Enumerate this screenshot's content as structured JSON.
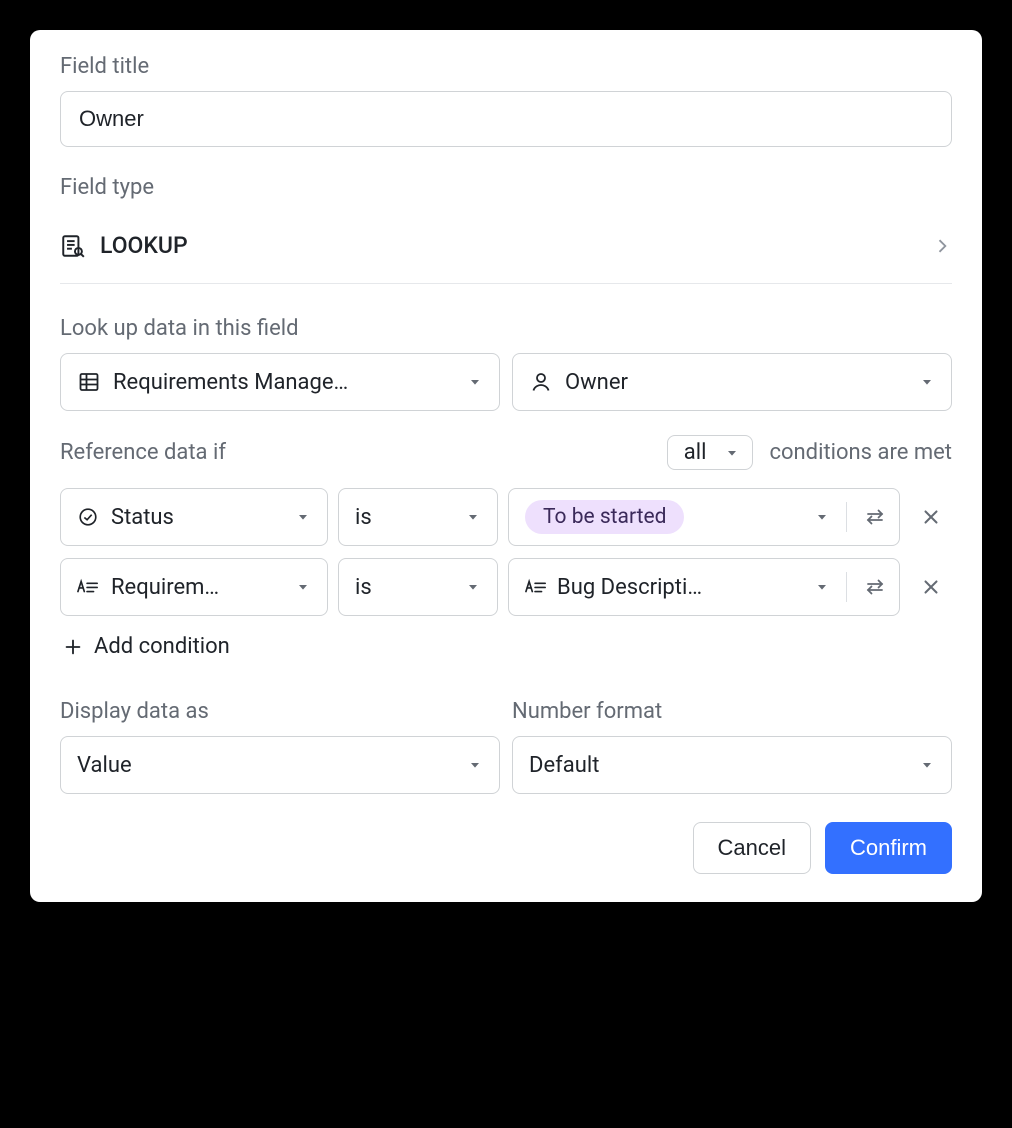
{
  "labels": {
    "field_title": "Field title",
    "field_type": "Field type",
    "lookup_data": "Look up data in this field",
    "reference_data_if": "Reference data if",
    "conditions_are_met": "conditions are met",
    "add_condition": "Add condition",
    "display_data_as": "Display data as",
    "number_format": "Number format"
  },
  "field_title_value": "Owner",
  "field_type_value": "LOOKUP",
  "lookup": {
    "table": "Requirements Manage…",
    "field": "Owner"
  },
  "match_mode": "all",
  "conditions": [
    {
      "field_icon": "status",
      "field": "Status",
      "operator": "is",
      "value_type": "pill",
      "value": "To be started",
      "value_icon": ""
    },
    {
      "field_icon": "text",
      "field": "Requirem…",
      "operator": "is",
      "value_type": "text",
      "value": "Bug Descripti…",
      "value_icon": "text"
    }
  ],
  "display_as": "Value",
  "number_format": "Default",
  "buttons": {
    "cancel": "Cancel",
    "confirm": "Confirm"
  }
}
